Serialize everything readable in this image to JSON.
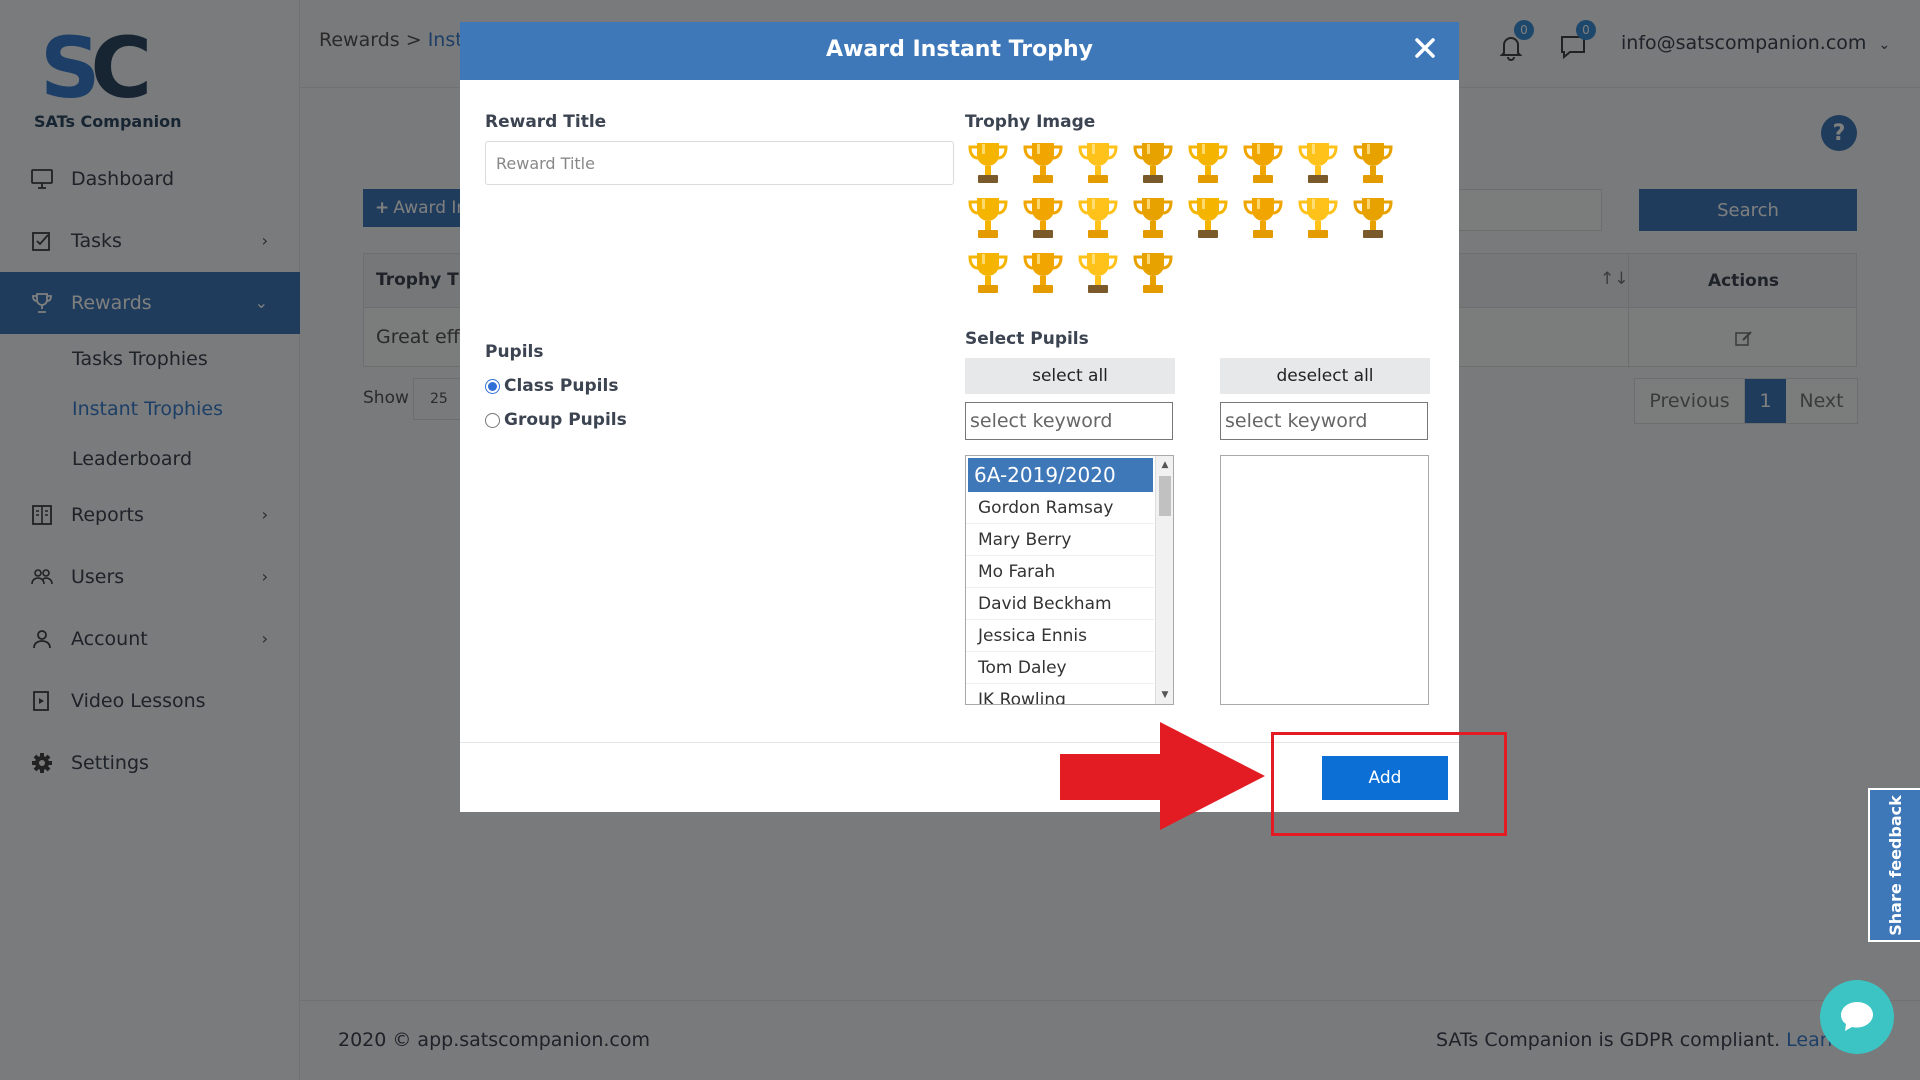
{
  "app": {
    "logo_text": "SATs Companion"
  },
  "sidebar": {
    "items": [
      {
        "label": "Dashboard",
        "icon": "monitor-icon"
      },
      {
        "label": "Tasks",
        "icon": "checklist-icon",
        "has_children": true
      },
      {
        "label": "Rewards",
        "icon": "trophy-icon",
        "has_children": true,
        "active": true
      },
      {
        "label": "Reports",
        "icon": "report-icon",
        "has_children": true
      },
      {
        "label": "Users",
        "icon": "users-icon",
        "has_children": true
      },
      {
        "label": "Account",
        "icon": "account-icon",
        "has_children": true
      },
      {
        "label": "Video Lessons",
        "icon": "video-icon"
      },
      {
        "label": "Settings",
        "icon": "gear-icon"
      }
    ],
    "rewards_subitems": [
      "Tasks Trophies",
      "Instant Trophies",
      "Leaderboard"
    ]
  },
  "topbar": {
    "breadcrumb_root": "Rewards",
    "breadcrumb_sep": ">",
    "breadcrumb_current": "Inst",
    "notifications_count": "0",
    "messages_count": "0",
    "user_email": "info@satscompanion.com"
  },
  "background": {
    "help": "?",
    "award_button": "Award In",
    "search_button": "Search",
    "table": {
      "headers": {
        "title": "Trophy Tit",
        "sort": "↑↓",
        "actions": "Actions"
      },
      "rows": [
        {
          "title": "Great eff"
        }
      ]
    },
    "show_label": "Show",
    "show_value": "25",
    "pagination": {
      "previous": "Previous",
      "current": "1",
      "next": "Next"
    },
    "footer_left": "2020 © app.satscompanion.com",
    "footer_right": "SATs Companion is GDPR compliant.",
    "footer_link": "Learn"
  },
  "modal": {
    "title": "Award Instant Trophy",
    "reward_title_label": "Reward Title",
    "reward_title_placeholder": "Reward Title",
    "reward_title_value": "",
    "trophy_image_label": "Trophy Image",
    "trophy_count": 20,
    "pupils_label": "Pupils",
    "pupils_options": [
      {
        "label": "Class Pupils",
        "checked": true
      },
      {
        "label": "Group Pupils",
        "checked": false
      }
    ],
    "select_pupils_label": "Select Pupils",
    "select_all": "select all",
    "deselect_all": "deselect all",
    "keyword_placeholder": "select keyword",
    "class_group": "6A-2019/2020",
    "pupils": [
      "Gordon Ramsay",
      "Mary Berry",
      "Mo Farah",
      "David Beckham",
      "Jessica Ennis",
      "Tom Daley",
      "JK Rowling"
    ],
    "add_button": "Add"
  },
  "widgets": {
    "feedback": "Share feedback"
  },
  "colors": {
    "primary": "#3e78b8",
    "add_button": "#0b6fd6",
    "annotation": "#e31b23",
    "chat": "#3bc4c3"
  }
}
